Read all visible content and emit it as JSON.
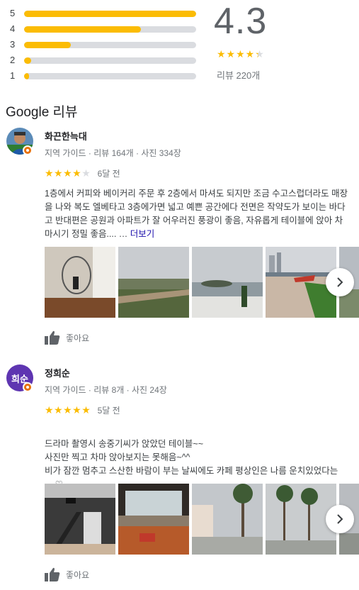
{
  "summary": {
    "histogram": [
      {
        "label": "5",
        "fraction": 1.0
      },
      {
        "label": "4",
        "fraction": 0.68
      },
      {
        "label": "3",
        "fraction": 0.27
      },
      {
        "label": "2",
        "fraction": 0.04
      },
      {
        "label": "1",
        "fraction": 0.03
      }
    ],
    "score": "4.3",
    "stars": "★★★★★",
    "count": "리뷰 220개"
  },
  "section_title": "Google 리뷰",
  "reviews": [
    {
      "author": "화끈한늑대",
      "meta": "지역 가이드 · 리뷰 164개 · 사진 334장",
      "stars_on": "★★★★",
      "stars_off": "★",
      "time": "6달 전",
      "text": "1층에서 커피와 베이커리 주문 후 2층에서 마셔도 되지만 조금 수고스럽더라도 매장을 나와 복도 엘베타고 3층에가면 넓고 예쁜 공간에다 전면은 작약도가 보이는 바다고 반대편은 공원과 아파트가 잘 어우러진 풍광이 좋음, 자유롭게 테이블에 앉아 차 마시기 정밀 좋음.... … ",
      "more": "더보기",
      "like": "좋아요"
    },
    {
      "author": "정희순",
      "avatar_text": "희순",
      "meta": "지역 가이드 · 리뷰 8개 · 사진 24장",
      "stars_on": "★★★★★",
      "stars_off": "",
      "time": "5달 전",
      "text": "드라마 촬영시 송중기씨가 앉았던 테이블~~\n사진만 찍고 차마 앉아보지는 못해음~^^\n비가 잠깐 멈추고 스산한 바람이 부는 날씨에도 카페 평상인은 나름 운치있었다는~~♡",
      "like": "좋아요"
    }
  ],
  "colors": {
    "star": "#fbbc04",
    "bar_track": "#dadce0",
    "link": "#1a0dab",
    "badge": "#e8710a",
    "avatar2": "#5e35b1"
  }
}
